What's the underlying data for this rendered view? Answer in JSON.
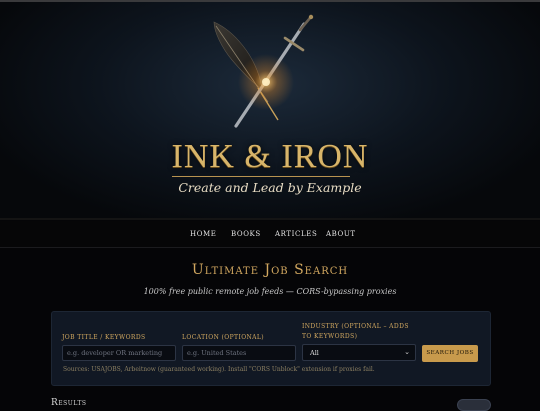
{
  "brand": {
    "name": "INK & IRON",
    "tagline": "Create and Lead by Example"
  },
  "nav": {
    "items": [
      "Home",
      "Books",
      "Articles",
      "About"
    ]
  },
  "page": {
    "title": "Ultimate Job Search",
    "subtitle": "100% free public remote job feeds — CORS-bypassing proxies"
  },
  "search": {
    "keywords_label": "Job Title / Keywords",
    "keywords_placeholder": "e.g. developer OR marketing",
    "location_label": "Location (optional)",
    "location_placeholder": "e.g. United States",
    "industry_label": "Industry (optional – adds to keywords)",
    "industry_value": "All",
    "button_label": "Search Jobs",
    "sources_note": "Sources: USAJOBS, Arbeitnow (guaranteed working). Install \"CORS Unblock\" extension if proxies fail."
  },
  "results": {
    "heading": "Results"
  },
  "colors": {
    "accent_gold": "#d2a860",
    "button_gold": "#c89a4c",
    "panel_bg": "#111824"
  }
}
